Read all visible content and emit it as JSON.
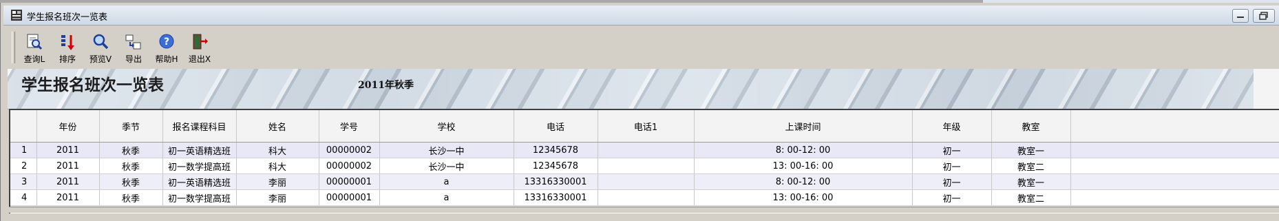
{
  "window": {
    "title": "学生报名班次一览表"
  },
  "toolbar": [
    {
      "name": "query-button",
      "label": "查询L",
      "icon": "query-icon"
    },
    {
      "name": "sort-button",
      "label": "排序",
      "icon": "sort-icon"
    },
    {
      "name": "preview-button",
      "label": "预览V",
      "icon": "magnifier-icon"
    },
    {
      "name": "export-button",
      "label": "导出",
      "icon": "export-icon"
    },
    {
      "name": "help-button",
      "label": "帮助H",
      "icon": "help-icon"
    },
    {
      "name": "exit-button",
      "label": "退出X",
      "icon": "exit-icon"
    }
  ],
  "report": {
    "title": "学生报名班次一览表",
    "season": "2011年秋季"
  },
  "table": {
    "columns": [
      "",
      "年份",
      "季节",
      "报名课程科目",
      "姓名",
      "学号",
      "学校",
      "电话",
      "电话1",
      "上课时间",
      "年级",
      "教室",
      ""
    ],
    "rows": [
      [
        "1",
        "2011",
        "秋季",
        "初一英语精选班",
        "科大",
        "00000002",
        "长沙一中",
        "12345678",
        "",
        "8: 00-12: 00",
        "初一",
        "教室一",
        ""
      ],
      [
        "2",
        "2011",
        "秋季",
        "初一数学提高班",
        "科大",
        "00000002",
        "长沙一中",
        "12345678",
        "",
        "13: 00-16: 00",
        "初一",
        "教室二",
        ""
      ],
      [
        "3",
        "2011",
        "秋季",
        "初一英语精选班",
        "李丽",
        "00000001",
        "a",
        "13316330001",
        "",
        "8: 00-12: 00",
        "初一",
        "教室一",
        ""
      ],
      [
        "4",
        "2011",
        "秋季",
        "初一数学提高班",
        "李丽",
        "00000001",
        "a",
        "13316330001",
        "",
        "13: 00-16: 00",
        "初一",
        "教室二",
        ""
      ]
    ]
  }
}
